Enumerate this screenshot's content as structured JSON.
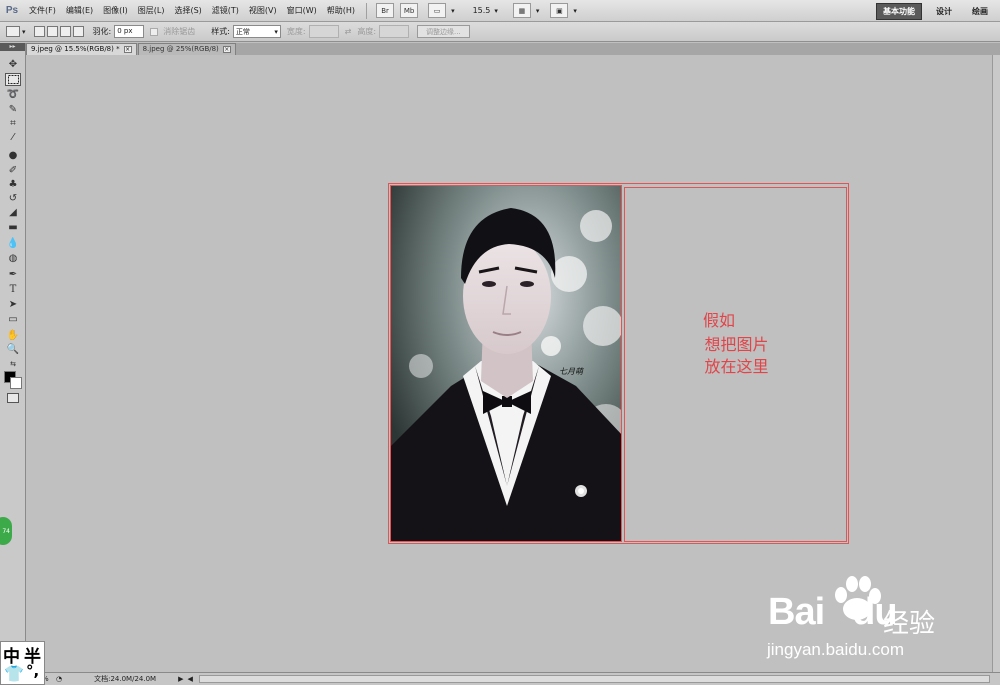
{
  "app": {
    "logo": "Ps",
    "menus": [
      "文件(F)",
      "编辑(E)",
      "图像(I)",
      "图层(L)",
      "选择(S)",
      "滤镜(T)",
      "视图(V)",
      "窗口(W)",
      "帮助(H)"
    ],
    "bar_buttons": [
      "Br",
      "Mb"
    ],
    "zoom_level": "15.5",
    "workspaces": [
      {
        "label": "基本功能",
        "active": true
      },
      {
        "label": "设计",
        "active": false
      },
      {
        "label": "绘画",
        "active": false
      }
    ]
  },
  "options": {
    "feather_label": "羽化:",
    "feather_value": "0 px",
    "antialias_label": "消除锯齿",
    "style_label": "样式:",
    "style_value": "正常",
    "width_label": "宽度:",
    "height_label": "高度:",
    "refine_edge_button": "调整边缘..."
  },
  "tabs": [
    {
      "label": "9.jpeg @ 15.5%(RGB/8) *",
      "active": true
    },
    {
      "label": "8.jpeg @ 25%(RGB/8)",
      "active": false
    }
  ],
  "tools": [
    "move-tool",
    "marquee-tool",
    "lasso-tool",
    "quick-selection-tool",
    "crop-tool",
    "eyedropper-tool",
    "healing-brush-tool",
    "brush-tool",
    "clone-stamp-tool",
    "history-brush-tool",
    "eraser-tool",
    "gradient-tool",
    "blur-tool",
    "dodge-tool",
    "pen-tool",
    "type-tool",
    "path-selection-tool",
    "rectangle-tool",
    "hand-tool",
    "zoom-tool"
  ],
  "colors": {
    "foreground": "#000000",
    "background": "#ffffff",
    "canvas_outline": "#e05555",
    "caption_text": "#e0454a",
    "workspace_bg": "#c0c0c0"
  },
  "canvas": {
    "photo_signature": "七月萌",
    "caption_lines": [
      "假如",
      "想把图片",
      "放在这里"
    ]
  },
  "status": {
    "zoom": "%",
    "doc_size": "文档:24.0M/24.0M"
  },
  "ime": {
    "chars": [
      "中",
      "半",
      "°,"
    ]
  },
  "watermark": {
    "brand": "Bai",
    "brand2": "du",
    "name_cn": "经验",
    "url": "jingyan.baidu.com"
  }
}
